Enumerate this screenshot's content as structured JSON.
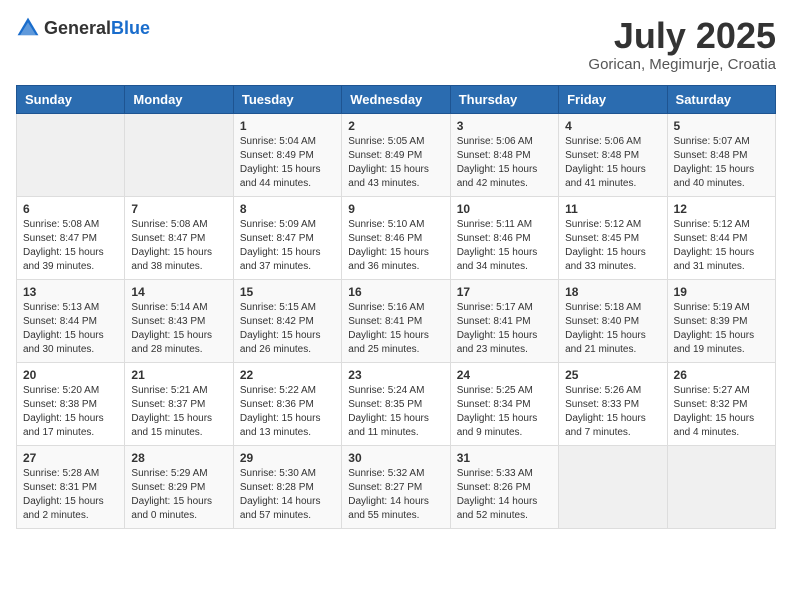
{
  "header": {
    "logo_general": "General",
    "logo_blue": "Blue",
    "title": "July 2025",
    "location": "Gorican, Megimurje, Croatia"
  },
  "days_of_week": [
    "Sunday",
    "Monday",
    "Tuesday",
    "Wednesday",
    "Thursday",
    "Friday",
    "Saturday"
  ],
  "weeks": [
    [
      {
        "day": null,
        "data": null
      },
      {
        "day": null,
        "data": null
      },
      {
        "day": "1",
        "data": "Sunrise: 5:04 AM\nSunset: 8:49 PM\nDaylight: 15 hours and 44 minutes."
      },
      {
        "day": "2",
        "data": "Sunrise: 5:05 AM\nSunset: 8:49 PM\nDaylight: 15 hours and 43 minutes."
      },
      {
        "day": "3",
        "data": "Sunrise: 5:06 AM\nSunset: 8:48 PM\nDaylight: 15 hours and 42 minutes."
      },
      {
        "day": "4",
        "data": "Sunrise: 5:06 AM\nSunset: 8:48 PM\nDaylight: 15 hours and 41 minutes."
      },
      {
        "day": "5",
        "data": "Sunrise: 5:07 AM\nSunset: 8:48 PM\nDaylight: 15 hours and 40 minutes."
      }
    ],
    [
      {
        "day": "6",
        "data": "Sunrise: 5:08 AM\nSunset: 8:47 PM\nDaylight: 15 hours and 39 minutes."
      },
      {
        "day": "7",
        "data": "Sunrise: 5:08 AM\nSunset: 8:47 PM\nDaylight: 15 hours and 38 minutes."
      },
      {
        "day": "8",
        "data": "Sunrise: 5:09 AM\nSunset: 8:47 PM\nDaylight: 15 hours and 37 minutes."
      },
      {
        "day": "9",
        "data": "Sunrise: 5:10 AM\nSunset: 8:46 PM\nDaylight: 15 hours and 36 minutes."
      },
      {
        "day": "10",
        "data": "Sunrise: 5:11 AM\nSunset: 8:46 PM\nDaylight: 15 hours and 34 minutes."
      },
      {
        "day": "11",
        "data": "Sunrise: 5:12 AM\nSunset: 8:45 PM\nDaylight: 15 hours and 33 minutes."
      },
      {
        "day": "12",
        "data": "Sunrise: 5:12 AM\nSunset: 8:44 PM\nDaylight: 15 hours and 31 minutes."
      }
    ],
    [
      {
        "day": "13",
        "data": "Sunrise: 5:13 AM\nSunset: 8:44 PM\nDaylight: 15 hours and 30 minutes."
      },
      {
        "day": "14",
        "data": "Sunrise: 5:14 AM\nSunset: 8:43 PM\nDaylight: 15 hours and 28 minutes."
      },
      {
        "day": "15",
        "data": "Sunrise: 5:15 AM\nSunset: 8:42 PM\nDaylight: 15 hours and 26 minutes."
      },
      {
        "day": "16",
        "data": "Sunrise: 5:16 AM\nSunset: 8:41 PM\nDaylight: 15 hours and 25 minutes."
      },
      {
        "day": "17",
        "data": "Sunrise: 5:17 AM\nSunset: 8:41 PM\nDaylight: 15 hours and 23 minutes."
      },
      {
        "day": "18",
        "data": "Sunrise: 5:18 AM\nSunset: 8:40 PM\nDaylight: 15 hours and 21 minutes."
      },
      {
        "day": "19",
        "data": "Sunrise: 5:19 AM\nSunset: 8:39 PM\nDaylight: 15 hours and 19 minutes."
      }
    ],
    [
      {
        "day": "20",
        "data": "Sunrise: 5:20 AM\nSunset: 8:38 PM\nDaylight: 15 hours and 17 minutes."
      },
      {
        "day": "21",
        "data": "Sunrise: 5:21 AM\nSunset: 8:37 PM\nDaylight: 15 hours and 15 minutes."
      },
      {
        "day": "22",
        "data": "Sunrise: 5:22 AM\nSunset: 8:36 PM\nDaylight: 15 hours and 13 minutes."
      },
      {
        "day": "23",
        "data": "Sunrise: 5:24 AM\nSunset: 8:35 PM\nDaylight: 15 hours and 11 minutes."
      },
      {
        "day": "24",
        "data": "Sunrise: 5:25 AM\nSunset: 8:34 PM\nDaylight: 15 hours and 9 minutes."
      },
      {
        "day": "25",
        "data": "Sunrise: 5:26 AM\nSunset: 8:33 PM\nDaylight: 15 hours and 7 minutes."
      },
      {
        "day": "26",
        "data": "Sunrise: 5:27 AM\nSunset: 8:32 PM\nDaylight: 15 hours and 4 minutes."
      }
    ],
    [
      {
        "day": "27",
        "data": "Sunrise: 5:28 AM\nSunset: 8:31 PM\nDaylight: 15 hours and 2 minutes."
      },
      {
        "day": "28",
        "data": "Sunrise: 5:29 AM\nSunset: 8:29 PM\nDaylight: 15 hours and 0 minutes."
      },
      {
        "day": "29",
        "data": "Sunrise: 5:30 AM\nSunset: 8:28 PM\nDaylight: 14 hours and 57 minutes."
      },
      {
        "day": "30",
        "data": "Sunrise: 5:32 AM\nSunset: 8:27 PM\nDaylight: 14 hours and 55 minutes."
      },
      {
        "day": "31",
        "data": "Sunrise: 5:33 AM\nSunset: 8:26 PM\nDaylight: 14 hours and 52 minutes."
      },
      {
        "day": null,
        "data": null
      },
      {
        "day": null,
        "data": null
      }
    ]
  ]
}
